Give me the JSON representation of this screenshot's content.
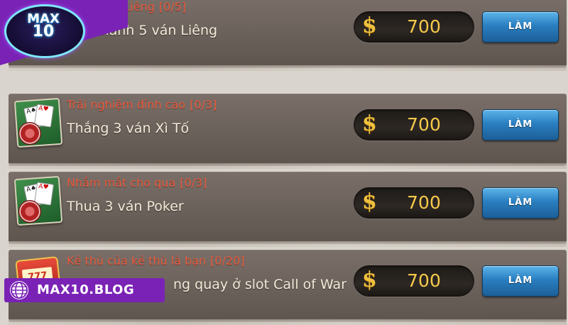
{
  "brand": {
    "logo_top": "MAX",
    "logo_num": "10",
    "watermark": "MAX10.BLOG"
  },
  "quests": [
    {
      "title": "ay Liêng",
      "progress": "[0/5]",
      "desc": "n thành 5 ván Liêng",
      "reward_symbol": "$",
      "reward": "700",
      "button": "LÀM",
      "icon": "cards-chip-icon"
    },
    {
      "title": "Trải nghiệm đỉnh cao",
      "progress": "[0/3]",
      "desc": "Thắng 3 ván Xì Tố",
      "reward_symbol": "$",
      "reward": "700",
      "button": "LÀM",
      "icon": "cards-chip-icon"
    },
    {
      "title": "Nhắm mắt cho qua",
      "progress": "[0/3]",
      "desc": "Thua 3 ván Poker",
      "reward_symbol": "$",
      "reward": "700",
      "button": "LÀM",
      "icon": "cards-chip-icon"
    },
    {
      "title": "Kẻ thù của kẻ thù là bạn",
      "progress": "[0/20]",
      "desc": "ng quay ở slot Call of War",
      "reward_symbol": "$",
      "reward": "700",
      "button": "LÀM",
      "icon": "slot-machine-icon"
    }
  ],
  "slot_icon_text": "777",
  "colors": {
    "title": "#e9593c",
    "button": "#2a7fc0",
    "reward": "#f7c94a",
    "brand": "#7a22b5"
  }
}
